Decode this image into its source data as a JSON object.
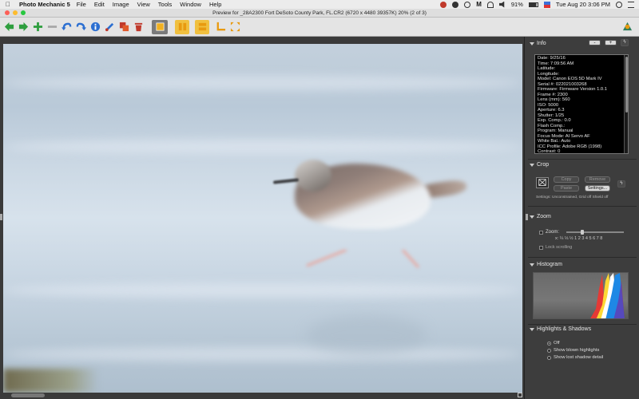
{
  "menubar": {
    "app_name": "Photo Mechanic 5",
    "items": [
      "File",
      "Edit",
      "Image",
      "View",
      "Tools",
      "Window",
      "Help"
    ],
    "battery": "91%",
    "datetime": "Tue Aug 20  3:06 PM"
  },
  "window": {
    "title": "Preview for _28A2300  Fort DeSoto County Park, FL.CR2 (6720 x 4480 39357K) 20% (2 of 3)"
  },
  "toolbar": {
    "icons": [
      "back-arrow-icon",
      "forward-arrow-icon",
      "add-icon",
      "remove-icon",
      "rotate-left-icon",
      "rotate-right-icon",
      "info-icon",
      "edit-icon",
      "copy-icon",
      "delete-icon",
      "single-view-icon",
      "compare-icon",
      "two-up-icon",
      "crop-icon",
      "expand-icon"
    ],
    "accent": "#f0b020"
  },
  "info": {
    "title": "Info",
    "minus_label": "-",
    "plus_label": "+",
    "lines": [
      "Date: 9/25/16",
      "Time: 7:09:56 AM",
      "Latitude:",
      "Longitude:",
      "Model: Canon EOS 5D Mark IV",
      "Serial #: 022021003268",
      "Firmware: Firmware Version 1.0.1",
      "Frame #: 2300",
      "Lens (mm): 560",
      "ISO: 5000",
      "Aperture: 6.3",
      "Shutter: 1/25",
      "Exp. Comp.: 0.0",
      "Flash Comp.:",
      "Program: Manual",
      "Focus Mode: AI Servo AF",
      "White Bal.: Auto",
      "ICC Profile: Adobe RGB (1998)",
      "Contrast: 0"
    ]
  },
  "crop": {
    "title": "Crop",
    "copy_label": "Copy",
    "remove_label": "Remove",
    "paste_label": "Paste",
    "settings_label": "Settings...",
    "settings_text": "Settings:    Unconstrained, Grid off Shield off"
  },
  "zoom": {
    "title": "Zoom",
    "zoom_label": "Zoom:",
    "scale": "x:  ¼ ⅓ ½  1   2   3   4   5   6   7   8",
    "lock_label": "Lock scrolling",
    "slider_value": 0.25
  },
  "histogram": {
    "title": "Histogram"
  },
  "highlights": {
    "title": "Highlights & Shadows",
    "options": [
      "Off",
      "Show blown highlights",
      "Show lost shadow detail"
    ],
    "selected": 0
  }
}
